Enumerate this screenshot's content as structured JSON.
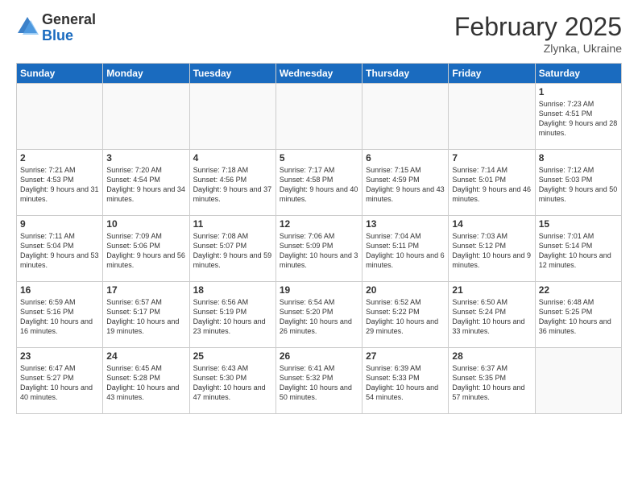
{
  "logo": {
    "general": "General",
    "blue": "Blue"
  },
  "title": {
    "month_year": "February 2025",
    "location": "Zlynka, Ukraine"
  },
  "days_of_week": [
    "Sunday",
    "Monday",
    "Tuesday",
    "Wednesday",
    "Thursday",
    "Friday",
    "Saturday"
  ],
  "weeks": [
    [
      {
        "day": "",
        "info": ""
      },
      {
        "day": "",
        "info": ""
      },
      {
        "day": "",
        "info": ""
      },
      {
        "day": "",
        "info": ""
      },
      {
        "day": "",
        "info": ""
      },
      {
        "day": "",
        "info": ""
      },
      {
        "day": "1",
        "info": "Sunrise: 7:23 AM\nSunset: 4:51 PM\nDaylight: 9 hours and 28 minutes."
      }
    ],
    [
      {
        "day": "2",
        "info": "Sunrise: 7:21 AM\nSunset: 4:53 PM\nDaylight: 9 hours and 31 minutes."
      },
      {
        "day": "3",
        "info": "Sunrise: 7:20 AM\nSunset: 4:54 PM\nDaylight: 9 hours and 34 minutes."
      },
      {
        "day": "4",
        "info": "Sunrise: 7:18 AM\nSunset: 4:56 PM\nDaylight: 9 hours and 37 minutes."
      },
      {
        "day": "5",
        "info": "Sunrise: 7:17 AM\nSunset: 4:58 PM\nDaylight: 9 hours and 40 minutes."
      },
      {
        "day": "6",
        "info": "Sunrise: 7:15 AM\nSunset: 4:59 PM\nDaylight: 9 hours and 43 minutes."
      },
      {
        "day": "7",
        "info": "Sunrise: 7:14 AM\nSunset: 5:01 PM\nDaylight: 9 hours and 46 minutes."
      },
      {
        "day": "8",
        "info": "Sunrise: 7:12 AM\nSunset: 5:03 PM\nDaylight: 9 hours and 50 minutes."
      }
    ],
    [
      {
        "day": "9",
        "info": "Sunrise: 7:11 AM\nSunset: 5:04 PM\nDaylight: 9 hours and 53 minutes."
      },
      {
        "day": "10",
        "info": "Sunrise: 7:09 AM\nSunset: 5:06 PM\nDaylight: 9 hours and 56 minutes."
      },
      {
        "day": "11",
        "info": "Sunrise: 7:08 AM\nSunset: 5:07 PM\nDaylight: 9 hours and 59 minutes."
      },
      {
        "day": "12",
        "info": "Sunrise: 7:06 AM\nSunset: 5:09 PM\nDaylight: 10 hours and 3 minutes."
      },
      {
        "day": "13",
        "info": "Sunrise: 7:04 AM\nSunset: 5:11 PM\nDaylight: 10 hours and 6 minutes."
      },
      {
        "day": "14",
        "info": "Sunrise: 7:03 AM\nSunset: 5:12 PM\nDaylight: 10 hours and 9 minutes."
      },
      {
        "day": "15",
        "info": "Sunrise: 7:01 AM\nSunset: 5:14 PM\nDaylight: 10 hours and 12 minutes."
      }
    ],
    [
      {
        "day": "16",
        "info": "Sunrise: 6:59 AM\nSunset: 5:16 PM\nDaylight: 10 hours and 16 minutes."
      },
      {
        "day": "17",
        "info": "Sunrise: 6:57 AM\nSunset: 5:17 PM\nDaylight: 10 hours and 19 minutes."
      },
      {
        "day": "18",
        "info": "Sunrise: 6:56 AM\nSunset: 5:19 PM\nDaylight: 10 hours and 23 minutes."
      },
      {
        "day": "19",
        "info": "Sunrise: 6:54 AM\nSunset: 5:20 PM\nDaylight: 10 hours and 26 minutes."
      },
      {
        "day": "20",
        "info": "Sunrise: 6:52 AM\nSunset: 5:22 PM\nDaylight: 10 hours and 29 minutes."
      },
      {
        "day": "21",
        "info": "Sunrise: 6:50 AM\nSunset: 5:24 PM\nDaylight: 10 hours and 33 minutes."
      },
      {
        "day": "22",
        "info": "Sunrise: 6:48 AM\nSunset: 5:25 PM\nDaylight: 10 hours and 36 minutes."
      }
    ],
    [
      {
        "day": "23",
        "info": "Sunrise: 6:47 AM\nSunset: 5:27 PM\nDaylight: 10 hours and 40 minutes."
      },
      {
        "day": "24",
        "info": "Sunrise: 6:45 AM\nSunset: 5:28 PM\nDaylight: 10 hours and 43 minutes."
      },
      {
        "day": "25",
        "info": "Sunrise: 6:43 AM\nSunset: 5:30 PM\nDaylight: 10 hours and 47 minutes."
      },
      {
        "day": "26",
        "info": "Sunrise: 6:41 AM\nSunset: 5:32 PM\nDaylight: 10 hours and 50 minutes."
      },
      {
        "day": "27",
        "info": "Sunrise: 6:39 AM\nSunset: 5:33 PM\nDaylight: 10 hours and 54 minutes."
      },
      {
        "day": "28",
        "info": "Sunrise: 6:37 AM\nSunset: 5:35 PM\nDaylight: 10 hours and 57 minutes."
      },
      {
        "day": "",
        "info": ""
      }
    ]
  ]
}
